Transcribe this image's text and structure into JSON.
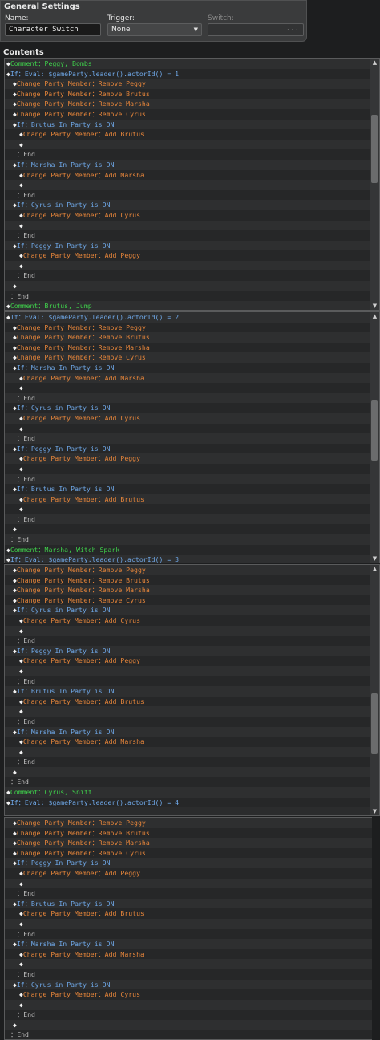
{
  "general": {
    "title": "General Settings",
    "name_label": "Name:",
    "name_value": "Character Switch",
    "trigger_label": "Trigger:",
    "trigger_value": "None",
    "switch_label": "Switch:",
    "switch_value": "",
    "switch_button": "..."
  },
  "contents_title": "Contents",
  "panels": [
    {
      "lines": [
        {
          "i": 1,
          "t": "comment",
          "s": "Comment：Peggy, Bombs"
        },
        {
          "i": 1,
          "t": "if",
          "s": "If：Eval: $gameParty.leader().actorId() = 1"
        },
        {
          "i": 2,
          "t": "member",
          "s": "Change Party Member：Remove Peggy"
        },
        {
          "i": 2,
          "t": "member",
          "s": "Change Party Member：Remove Brutus"
        },
        {
          "i": 2,
          "t": "member",
          "s": "Change Party Member：Remove Marsha"
        },
        {
          "i": 2,
          "t": "member",
          "s": "Change Party Member：Remove Cyrus"
        },
        {
          "i": 2,
          "t": "if",
          "s": "If：Brutus In Party is ON"
        },
        {
          "i": 3,
          "t": "member",
          "s": "Change Party Member：Add Brutus"
        },
        {
          "i": 3,
          "t": "blank",
          "s": ""
        },
        {
          "i": 2,
          "t": "end",
          "s": "：End"
        },
        {
          "i": 2,
          "t": "if",
          "s": "If：Marsha In Party is ON"
        },
        {
          "i": 3,
          "t": "member",
          "s": "Change Party Member：Add Marsha"
        },
        {
          "i": 3,
          "t": "blank",
          "s": ""
        },
        {
          "i": 2,
          "t": "end",
          "s": "：End"
        },
        {
          "i": 2,
          "t": "if",
          "s": "If：Cyrus in Party is ON"
        },
        {
          "i": 3,
          "t": "member",
          "s": "Change Party Member：Add Cyrus"
        },
        {
          "i": 3,
          "t": "blank",
          "s": ""
        },
        {
          "i": 2,
          "t": "end",
          "s": "：End"
        },
        {
          "i": 2,
          "t": "if",
          "s": "If：Peggy In Party is ON"
        },
        {
          "i": 3,
          "t": "member",
          "s": "Change Party Member：Add Peggy"
        },
        {
          "i": 3,
          "t": "blank",
          "s": ""
        },
        {
          "i": 2,
          "t": "end",
          "s": "：End"
        },
        {
          "i": 2,
          "t": "blank",
          "s": ""
        },
        {
          "i": 1,
          "t": "end",
          "s": "：End"
        },
        {
          "i": 1,
          "t": "comment",
          "s": "Comment：Brutus, Jump"
        }
      ]
    },
    {
      "lines": [
        {
          "i": 1,
          "t": "if",
          "s": "If：Eval: $gameParty.leader().actorId() = 2"
        },
        {
          "i": 2,
          "t": "member",
          "s": "Change Party Member：Remove Peggy"
        },
        {
          "i": 2,
          "t": "member",
          "s": "Change Party Member：Remove Brutus"
        },
        {
          "i": 2,
          "t": "member",
          "s": "Change Party Member：Remove Marsha"
        },
        {
          "i": 2,
          "t": "member",
          "s": "Change Party Member：Remove Cyrus"
        },
        {
          "i": 2,
          "t": "if",
          "s": "If：Marsha In Party is ON"
        },
        {
          "i": 3,
          "t": "member",
          "s": "Change Party Member：Add Marsha"
        },
        {
          "i": 3,
          "t": "blank",
          "s": ""
        },
        {
          "i": 2,
          "t": "end",
          "s": "：End"
        },
        {
          "i": 2,
          "t": "if",
          "s": "If：Cyrus in Party is ON"
        },
        {
          "i": 3,
          "t": "member",
          "s": "Change Party Member：Add Cyrus"
        },
        {
          "i": 3,
          "t": "blank",
          "s": ""
        },
        {
          "i": 2,
          "t": "end",
          "s": "：End"
        },
        {
          "i": 2,
          "t": "if",
          "s": "If：Peggy In Party is ON"
        },
        {
          "i": 3,
          "t": "member",
          "s": "Change Party Member：Add Peggy"
        },
        {
          "i": 3,
          "t": "blank",
          "s": ""
        },
        {
          "i": 2,
          "t": "end",
          "s": "：End"
        },
        {
          "i": 2,
          "t": "if",
          "s": "If：Brutus In Party is ON"
        },
        {
          "i": 3,
          "t": "member",
          "s": "Change Party Member：Add Brutus"
        },
        {
          "i": 3,
          "t": "blank",
          "s": ""
        },
        {
          "i": 2,
          "t": "end",
          "s": "：End"
        },
        {
          "i": 2,
          "t": "blank",
          "s": ""
        },
        {
          "i": 1,
          "t": "end",
          "s": "：End"
        },
        {
          "i": 1,
          "t": "comment",
          "s": "Comment：Marsha, Witch Spark"
        },
        {
          "i": 1,
          "t": "if",
          "s": "If：Eval: $gameParty.leader().actorId() = 3"
        }
      ]
    },
    {
      "lines": [
        {
          "i": 2,
          "t": "member",
          "s": "Change Party Member：Remove Peggy"
        },
        {
          "i": 2,
          "t": "member",
          "s": "Change Party Member：Remove Brutus"
        },
        {
          "i": 2,
          "t": "member",
          "s": "Change Party Member：Remove Marsha"
        },
        {
          "i": 2,
          "t": "member",
          "s": "Change Party Member：Remove Cyrus"
        },
        {
          "i": 2,
          "t": "if",
          "s": "If：Cyrus in Party is ON"
        },
        {
          "i": 3,
          "t": "member",
          "s": "Change Party Member：Add Cyrus"
        },
        {
          "i": 3,
          "t": "blank",
          "s": ""
        },
        {
          "i": 2,
          "t": "end",
          "s": "：End"
        },
        {
          "i": 2,
          "t": "if",
          "s": "If：Peggy In Party is ON"
        },
        {
          "i": 3,
          "t": "member",
          "s": "Change Party Member：Add Peggy"
        },
        {
          "i": 3,
          "t": "blank",
          "s": ""
        },
        {
          "i": 2,
          "t": "end",
          "s": "：End"
        },
        {
          "i": 2,
          "t": "if",
          "s": "If：Brutus In Party is ON"
        },
        {
          "i": 3,
          "t": "member",
          "s": "Change Party Member：Add Brutus"
        },
        {
          "i": 3,
          "t": "blank",
          "s": ""
        },
        {
          "i": 2,
          "t": "end",
          "s": "：End"
        },
        {
          "i": 2,
          "t": "if",
          "s": "If：Marsha In Party is ON"
        },
        {
          "i": 3,
          "t": "member",
          "s": "Change Party Member：Add Marsha"
        },
        {
          "i": 3,
          "t": "blank",
          "s": ""
        },
        {
          "i": 2,
          "t": "end",
          "s": "：End"
        },
        {
          "i": 2,
          "t": "blank",
          "s": ""
        },
        {
          "i": 1,
          "t": "end",
          "s": "：End"
        },
        {
          "i": 1,
          "t": "comment",
          "s": "Comment：Cyrus, Sniff"
        },
        {
          "i": 1,
          "t": "if",
          "s": "If：Eval: $gameParty.leader().actorId() = 4"
        }
      ]
    },
    {
      "lines": [
        {
          "i": 2,
          "t": "member",
          "s": "Change Party Member：Remove Peggy"
        },
        {
          "i": 2,
          "t": "member",
          "s": "Change Party Member：Remove Brutus"
        },
        {
          "i": 2,
          "t": "member",
          "s": "Change Party Member：Remove Marsha"
        },
        {
          "i": 2,
          "t": "member",
          "s": "Change Party Member：Remove Cyrus"
        },
        {
          "i": 2,
          "t": "if",
          "s": "If：Peggy In Party is ON"
        },
        {
          "i": 3,
          "t": "member",
          "s": "Change Party Member：Add Peggy"
        },
        {
          "i": 3,
          "t": "blank",
          "s": ""
        },
        {
          "i": 2,
          "t": "end",
          "s": "：End"
        },
        {
          "i": 2,
          "t": "if",
          "s": "If：Brutus In Party is ON"
        },
        {
          "i": 3,
          "t": "member",
          "s": "Change Party Member：Add Brutus"
        },
        {
          "i": 3,
          "t": "blank",
          "s": ""
        },
        {
          "i": 2,
          "t": "end",
          "s": "：End"
        },
        {
          "i": 2,
          "t": "if",
          "s": "If：Marsha In Party is ON"
        },
        {
          "i": 3,
          "t": "member",
          "s": "Change Party Member：Add Marsha"
        },
        {
          "i": 3,
          "t": "blank",
          "s": ""
        },
        {
          "i": 2,
          "t": "end",
          "s": "：End"
        },
        {
          "i": 2,
          "t": "if",
          "s": "If：Cyrus in Party is ON"
        },
        {
          "i": 3,
          "t": "member",
          "s": "Change Party Member：Add Cyrus"
        },
        {
          "i": 3,
          "t": "blank",
          "s": ""
        },
        {
          "i": 2,
          "t": "end",
          "s": "：End"
        },
        {
          "i": 2,
          "t": "blank",
          "s": ""
        },
        {
          "i": 1,
          "t": "end",
          "s": "：End"
        },
        {
          "i": 1,
          "t": "blank",
          "s": ""
        }
      ]
    }
  ]
}
